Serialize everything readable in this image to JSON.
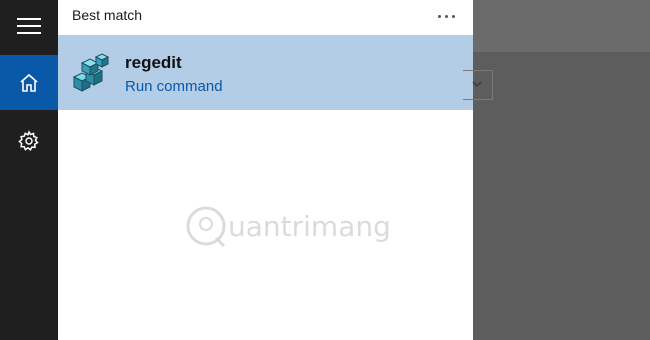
{
  "rail": {
    "items": [
      {
        "icon": "hamburger-menu-icon"
      },
      {
        "icon": "home-icon",
        "selected": true
      },
      {
        "icon": "settings-gear-icon"
      }
    ],
    "accent_color": "#0a58a8"
  },
  "panel": {
    "header": "Best match",
    "more_icon": "more-options-icon"
  },
  "best_match": {
    "icon": "registry-editor-icon",
    "title": "regedit",
    "subtitle": "Run command",
    "highlight_color": "#b3cde6"
  },
  "watermark": {
    "text": "uantrimang",
    "logo_letter": "Q"
  }
}
